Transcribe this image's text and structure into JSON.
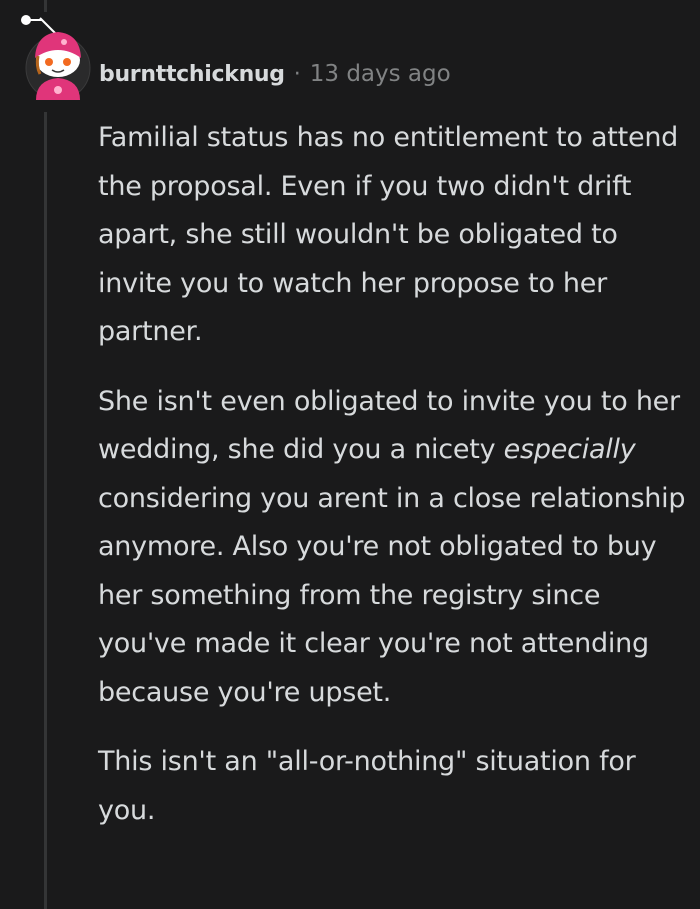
{
  "comment": {
    "author": "burnttchicknug",
    "separator": "·",
    "timestamp": "13 days ago",
    "avatar_icon": "snoo-avatar-icon",
    "paragraphs": [
      {
        "text": "Familial status has no entitlement to attend the proposal. Even if you two didn't drift apart, she still wouldn't be obligated to invite you to watch her propose to her partner."
      },
      {
        "before": "She isn't even obligated to invite you to her wedding, she did you a nicety ",
        "emphasis": "especially",
        "after": " considering you arent in a close relationship anymore. Also you're not obligated to buy her something from the registry since you've made it clear you're not attending because you're upset."
      },
      {
        "text": "This isn't an \"all-or-nothing\" situation for you."
      }
    ]
  },
  "colors": {
    "background": "#1a1a1b",
    "text": "#d7dadc",
    "meta": "#818384",
    "thread_line": "#343536",
    "avatar_accent": "#e0357a"
  }
}
